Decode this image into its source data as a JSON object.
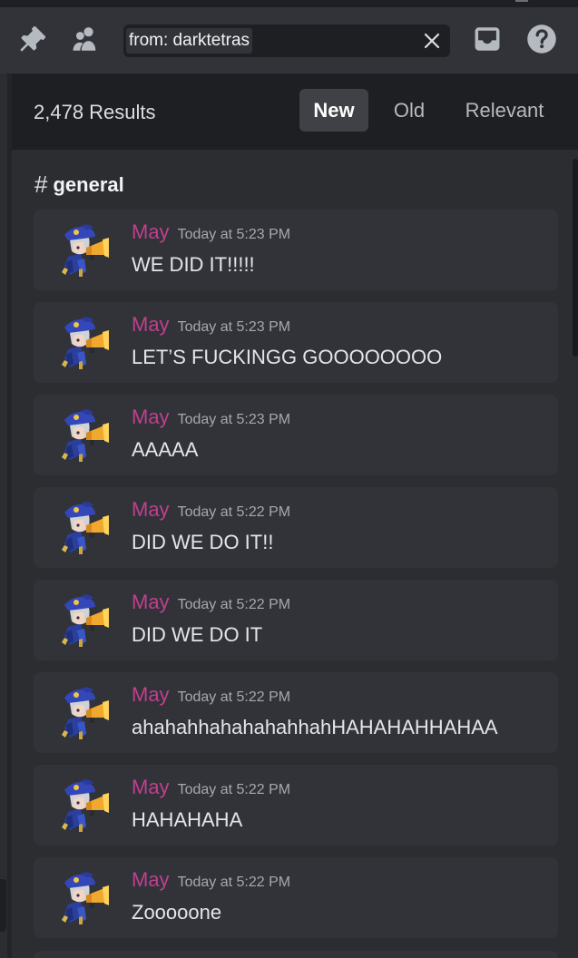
{
  "search": {
    "query_token": "from: darktetras"
  },
  "icons": {
    "pin": "pin-icon",
    "members": "members-icon",
    "clear": "close-icon",
    "inbox": "inbox-icon",
    "help": "help-icon"
  },
  "results": {
    "count": "2,478 Results",
    "sort_tabs": [
      {
        "label": "New",
        "active": true
      },
      {
        "label": "Old",
        "active": false
      },
      {
        "label": "Relevant",
        "active": false
      }
    ]
  },
  "channel": {
    "hash": "#",
    "name": "general"
  },
  "messages": [
    {
      "author": "May",
      "time": "Today at 5:23 PM",
      "text": "WE DID IT!!!!!"
    },
    {
      "author": "May",
      "time": "Today at 5:23 PM",
      "text": "LET’S FUCKINGG GOOOOOOOO"
    },
    {
      "author": "May",
      "time": "Today at 5:23 PM",
      "text": "AAAAA"
    },
    {
      "author": "May",
      "time": "Today at 5:22 PM",
      "text": "DID WE DO IT!!"
    },
    {
      "author": "May",
      "time": "Today at 5:22 PM",
      "text": "DID WE DO IT"
    },
    {
      "author": "May",
      "time": "Today at 5:22 PM",
      "text": "ahahahhahahahahhahHAHAHAHHAHAA"
    },
    {
      "author": "May",
      "time": "Today at 5:22 PM",
      "text": "HAHAHAHA"
    },
    {
      "author": "May",
      "time": "Today at 5:22 PM",
      "text": "Zooooone"
    }
  ],
  "colors": {
    "author": "#c13f8f",
    "card": "#313338",
    "panel": "#2b2d31",
    "header": "#1e1f22"
  }
}
